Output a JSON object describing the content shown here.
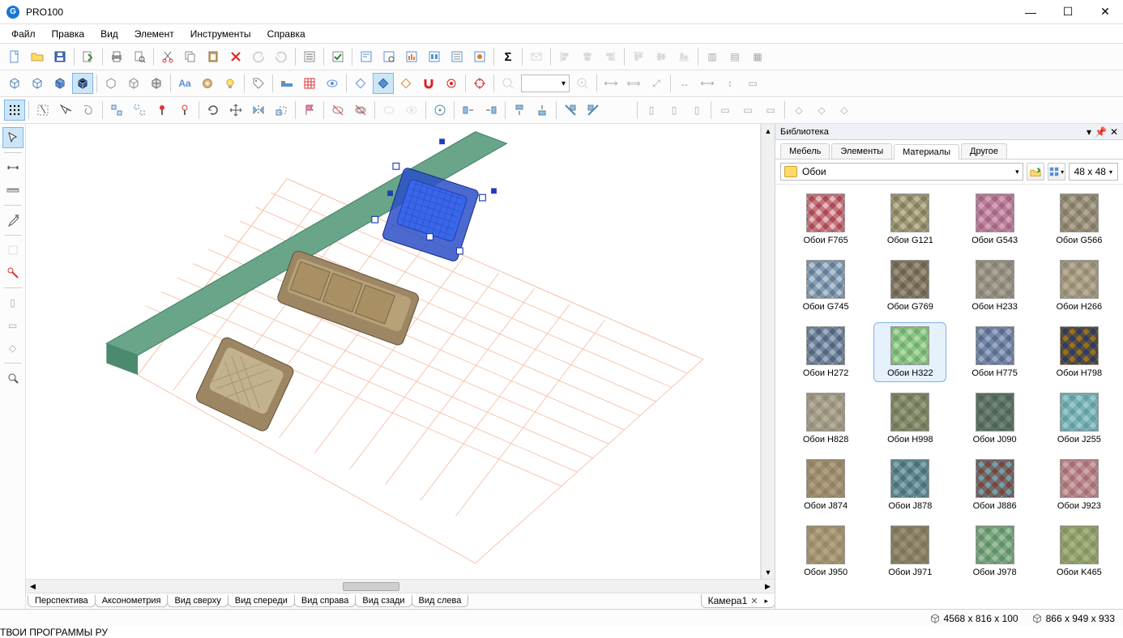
{
  "app": {
    "title": "PRO100"
  },
  "menu": {
    "items": [
      "Файл",
      "Правка",
      "Вид",
      "Элемент",
      "Инструменты",
      "Справка"
    ]
  },
  "viewport_tabs": {
    "items": [
      "Перспектива",
      "Аксонометрия",
      "Вид сверху",
      "Вид спереди",
      "Вид справа",
      "Вид сзади",
      "Вид слева"
    ],
    "extra": "Камера1"
  },
  "library": {
    "title": "Библиотека",
    "tabs": [
      "Мебель",
      "Элементы",
      "Материалы",
      "Другое"
    ],
    "active_tab": "Материалы",
    "folder": "Обои",
    "thumb_size": "48 x 48",
    "selected": "Обои H322",
    "materials": [
      {
        "name": "Обои F765",
        "c1": "#f0d9dc",
        "c2": "#d18a92"
      },
      {
        "name": "Обои G121",
        "c1": "#dcd9c8",
        "c2": "#b7b398"
      },
      {
        "name": "Обои G543",
        "c1": "#e8cbd8",
        "c2": "#cda1b8"
      },
      {
        "name": "Обои G566",
        "c1": "#d4cfc4",
        "c2": "#b7b09f"
      },
      {
        "name": "Обои G745",
        "c1": "#9fb3c4",
        "c2": "#d7e0e7"
      },
      {
        "name": "Обои G769",
        "c1": "#c7c1b4",
        "c2": "#a69f8e"
      },
      {
        "name": "Обои H233",
        "c1": "#d0cdc5",
        "c2": "#bab6ab"
      },
      {
        "name": "Обои H266",
        "c1": "#d9d3c6",
        "c2": "#c3bba9"
      },
      {
        "name": "Обои H272",
        "c1": "#8fa1b5",
        "c2": "#c9d2dc"
      },
      {
        "name": "Обои H322",
        "c1": "#a9d3a8",
        "c2": "#d4eccc"
      },
      {
        "name": "Обои H775",
        "c1": "#96a6be",
        "c2": "#c6cfdf"
      },
      {
        "name": "Обои H798",
        "c1": "#c7a95b",
        "c2": "#6e78a8"
      },
      {
        "name": "Обои H828",
        "c1": "#d7d3c8",
        "c2": "#c3beae"
      },
      {
        "name": "Обои H998",
        "c1": "#c3c9b4",
        "c2": "#a8ae95"
      },
      {
        "name": "Обои J090",
        "c1": "#aab9b0",
        "c2": "#8ea093"
      },
      {
        "name": "Обои J255",
        "c1": "#9ec9cc",
        "c2": "#c7e2e3"
      },
      {
        "name": "Обои J874",
        "c1": "#d3cab7",
        "c2": "#c1b69e"
      },
      {
        "name": "Обои J878",
        "c1": "#88aab0",
        "c2": "#b9cfd3"
      },
      {
        "name": "Обои J886",
        "c1": "#b2857f",
        "c2": "#a8cbd1"
      },
      {
        "name": "Обои J923",
        "c1": "#cfa7ab",
        "c2": "#e3cfd1"
      },
      {
        "name": "Обои J950",
        "c1": "#d6cdb8",
        "c2": "#c5bba1"
      },
      {
        "name": "Обои J971",
        "c1": "#c6c0ae",
        "c2": "#b3ac96"
      },
      {
        "name": "Обои J978",
        "c1": "#9cbfa3",
        "c2": "#c8dcc9"
      },
      {
        "name": "Обои K465",
        "c1": "#ced6b9",
        "c2": "#b8c29a"
      }
    ]
  },
  "status": {
    "dims1": "4568 x 816 x 100",
    "dims2": "866 x 949 x 933"
  },
  "watermark": "ТВОИ ПРОГРАММЫ РУ",
  "icons": {
    "new": "📄",
    "open": "📂",
    "save": "💾",
    "export": "📤",
    "print": "🖨",
    "preview": "🗎",
    "cut": "✂",
    "copy": "📋",
    "paste": "📄",
    "delete": "✖",
    "undo": "↶",
    "redo": "↷",
    "props": "☰",
    "check": "☑",
    "sigma": "Σ",
    "mail": "✉",
    "wire": "▱",
    "solid": "◧",
    "shade": "◨",
    "shade2": "◩",
    "cube1": "◫",
    "cube2": "▣",
    "cube3": "▤",
    "text": "Aa",
    "sphere": "●",
    "bulb": "💡",
    "tag": "🏷",
    "bed": "🛏",
    "grid": "▦",
    "eye": "👁",
    "diamond1": "◇",
    "diamond2": "◈",
    "diamond3": "◆",
    "magnet": "⊙",
    "target": "◎",
    "target2": "⦿",
    "zoom": "🔍",
    "zoomin": "🔍",
    "dim1": "⟷",
    "dim2": "⟺",
    "dimv": "↕",
    "sel": "⬚",
    "cursor": "↖",
    "pick": "↗",
    "move": "✥",
    "rotate": "↻",
    "mirror": "⇋",
    "scissors": "✂",
    "dropper": "💧",
    "group": "▦",
    "align": "≡",
    "flip": "⇄"
  }
}
